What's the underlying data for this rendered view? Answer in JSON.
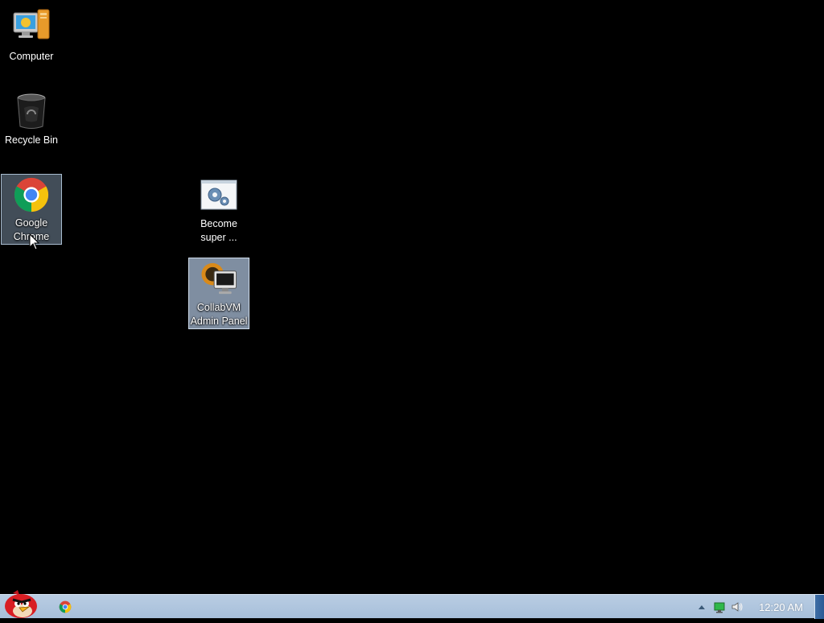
{
  "desktop": {
    "background_color": "#000000",
    "icons": [
      {
        "id": "computer",
        "label": "Computer",
        "icon": "computer-icon"
      },
      {
        "id": "recycle-bin",
        "label": "Recycle Bin",
        "icon": "recycle-bin-icon"
      },
      {
        "id": "google-chrome",
        "label": "Google Chrome",
        "icon": "chrome-icon",
        "selected": true
      },
      {
        "id": "become-super",
        "label": "Become super ...",
        "icon": "settings-gears-icon"
      },
      {
        "id": "collabvm-admin",
        "label": "CollabVM Admin Panel",
        "icon": "collabvm-monitor-icon",
        "selected": true
      }
    ]
  },
  "taskbar": {
    "start_button_icon": "angry-bird-icon",
    "pinned": [
      {
        "name": "Google Chrome",
        "icon": "chrome-icon"
      }
    ],
    "tray": {
      "show_hidden_icon": "chevron-up-icon",
      "network_icon": "network-icon",
      "volume_icon": "volume-icon",
      "clock": "12:20 AM"
    }
  },
  "colors": {
    "taskbar": "#a7bfda",
    "selection": "#a9bdd0"
  }
}
